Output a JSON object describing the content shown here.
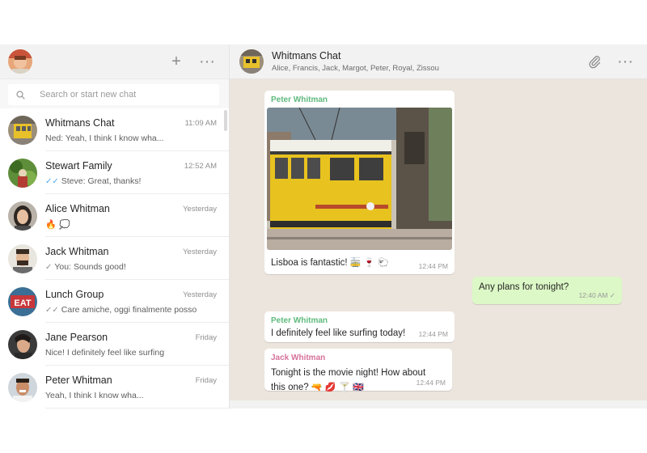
{
  "sidebar": {
    "new_chat_icon": "plus-icon",
    "menu_icon": "more-dots-icon",
    "menu_glyph": "···",
    "plus_glyph": "+",
    "search": {
      "placeholder": "Search or start new chat"
    },
    "chats": [
      {
        "name": "Whitmans Chat",
        "time": "11:09 AM",
        "preview": "Ned: Yeah, I think I know wha...",
        "ticks": "",
        "avatar": "tram-avatar"
      },
      {
        "name": "Stewart Family",
        "time": "12:52 AM",
        "preview": "Steve: Great, thanks!",
        "ticks": "✓✓",
        "ticks_color": "#4fa6e8",
        "avatar": "garden-avatar"
      },
      {
        "name": "Alice Whitman",
        "time": "Yesterday",
        "preview": "🔥 💭",
        "ticks": "",
        "avatar": "woman-avatar"
      },
      {
        "name": "Jack Whitman",
        "time": "Yesterday",
        "preview": "You: Sounds good!",
        "ticks": "✓",
        "avatar": "man-beard-avatar"
      },
      {
        "name": "Lunch Group",
        "time": "Yesterday",
        "preview": "Care amiche, oggi finalmente posso",
        "ticks": "✓✓",
        "avatar": "eat-sign-avatar"
      },
      {
        "name": "Jane Pearson",
        "time": "Friday",
        "preview": "Nice! I definitely feel like surfing",
        "ticks": "",
        "avatar": "jane-avatar"
      },
      {
        "name": "Peter Whitman",
        "time": "Friday",
        "preview": "Yeah, I think I know wha...",
        "ticks": "",
        "avatar": "peter-avatar"
      }
    ]
  },
  "conversation": {
    "title": "Whitmans Chat",
    "participants": "Alice, Francis, Jack, Margot, Peter, Royal, Zissou",
    "attach_icon": "paperclip-icon",
    "menu_glyph": "···",
    "messages": [
      {
        "sender": "Peter Whitman",
        "sender_color": "#5fba7d",
        "text": "Lisboa is fantastic!",
        "emoji": "🚋 🍷 🐑",
        "time": "12:44 PM",
        "image": "yellow-tram-photo"
      },
      {
        "sender": "",
        "text": "Any plans for tonight?",
        "time": "12:40 AM",
        "status": "✓"
      },
      {
        "sender": "Peter Whitman",
        "sender_color": "#5fba7d",
        "text": "I definitely feel like surfing today!",
        "time": "12:44 PM"
      },
      {
        "sender": "Jack Whitman",
        "sender_color": "#d7719a",
        "text": "Tonight is the movie night! How about this one?",
        "emoji": "🔫 💋 🍸 🇬🇧",
        "time": "12:44 PM"
      }
    ]
  },
  "colors": {
    "header_bg": "#f2f2f2",
    "chat_bg": "#ece5dd",
    "outgoing_bubble": "#dcf8c6",
    "read_ticks": "#4fa6e8"
  }
}
